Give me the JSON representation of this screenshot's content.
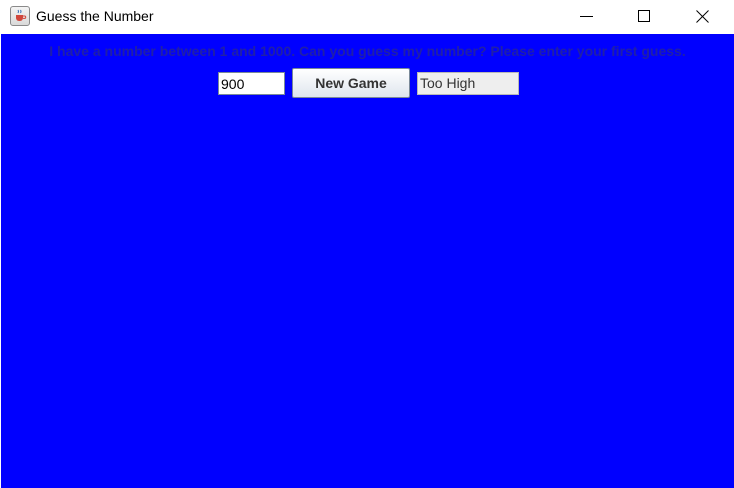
{
  "window": {
    "title": "Guess the Number",
    "app_icon": "java-coffee-cup-icon",
    "controls": {
      "minimize_icon": "minimize-icon",
      "maximize_icon": "maximize-icon",
      "close_icon": "close-icon"
    }
  },
  "game": {
    "prompt": "I have a number between 1 and 1000. Can you guess my number? Please enter your first guess.",
    "guess_value": "900",
    "new_game_label": "New Game",
    "result_text": "Too High"
  },
  "colors": {
    "background": "#0000ff",
    "prompt_text": "#1f1fa8",
    "titlebar": "#ffffff"
  }
}
